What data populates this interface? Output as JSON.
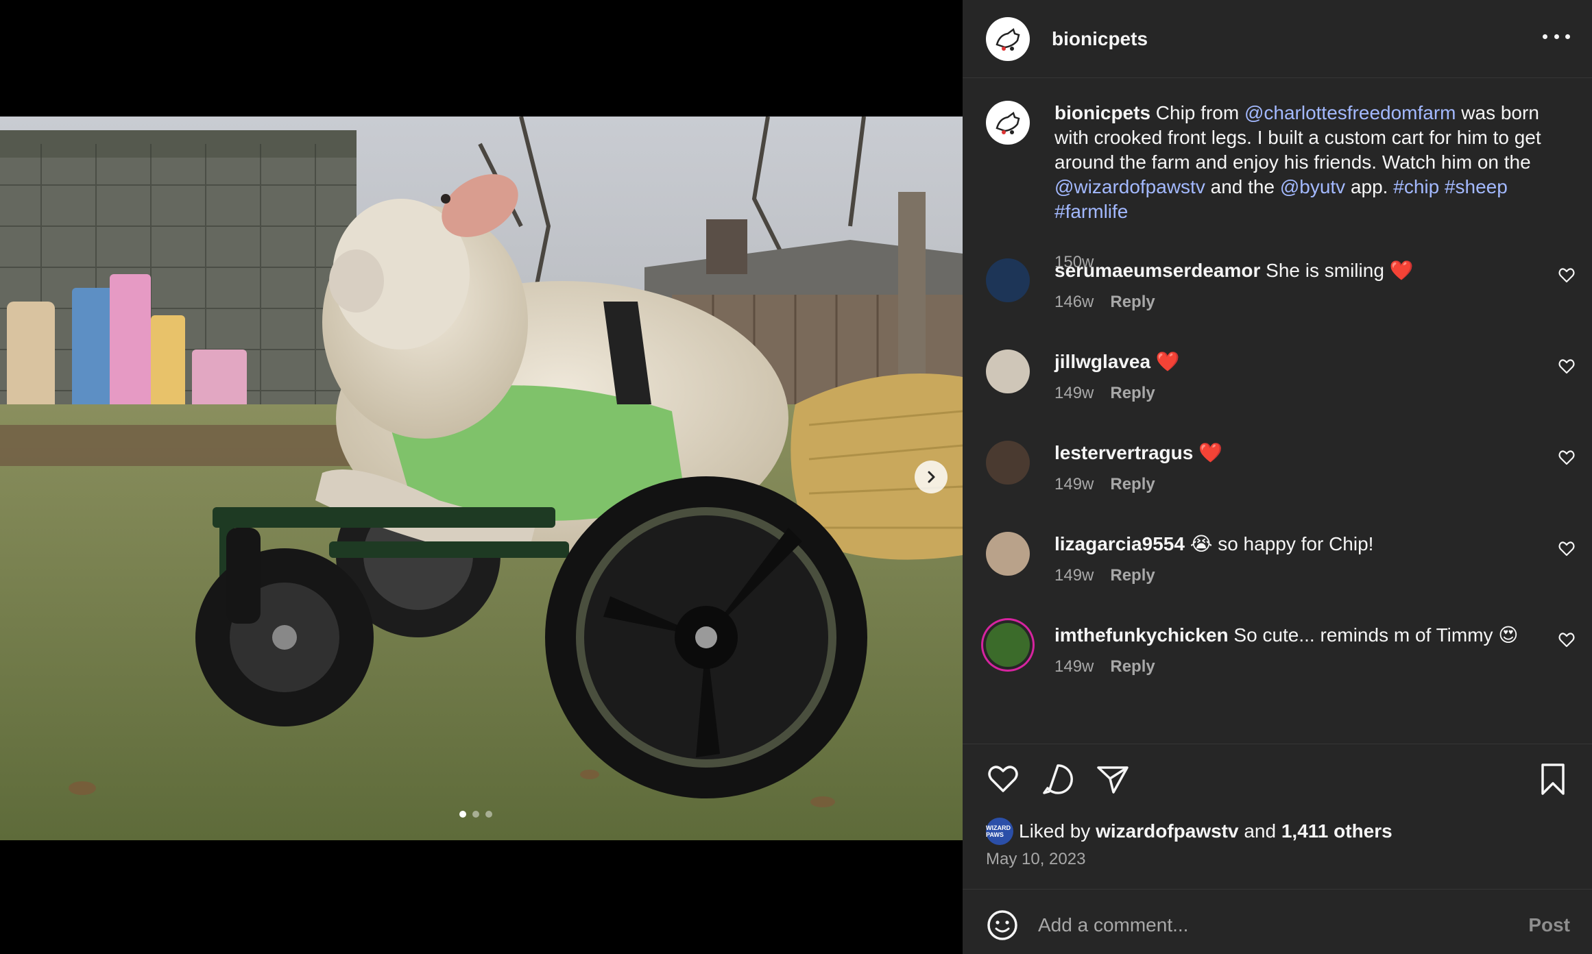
{
  "post": {
    "username": "bionicpets",
    "caption": {
      "user": "bionicpets",
      "parts": [
        {
          "text": " Chip from ",
          "mention": false
        },
        {
          "text": "@charlottesfreedomfarm",
          "mention": true
        },
        {
          "text": " was born with crooked front legs. I built a custom cart for him to get around the farm and enjoy his friends. Watch him on the ",
          "mention": false
        },
        {
          "text": "@wizardofpawstv",
          "mention": true
        },
        {
          "text": " and the ",
          "mention": false
        },
        {
          "text": "@byutv",
          "mention": true
        },
        {
          "text": " app. ",
          "mention": false
        },
        {
          "text": "#chip",
          "mention": true
        },
        {
          "text": " ",
          "mention": false
        },
        {
          "text": "#sheep",
          "mention": true
        },
        {
          "text": " ",
          "mention": false
        },
        {
          "text": "#farmlife",
          "mention": true
        }
      ],
      "age": "150w"
    },
    "comments": [
      {
        "user": "serumaeumserdeamor",
        "text": "She is smiling ❤️",
        "age": "146w",
        "reply": "Reply",
        "avatar_color": "#1d3557"
      },
      {
        "user": "jillwglavea",
        "text": "❤️",
        "age": "149w",
        "reply": "Reply",
        "avatar_color": "#cfc6b8"
      },
      {
        "user": "lestervertragus",
        "text": "❤️",
        "age": "149w",
        "reply": "Reply",
        "avatar_color": "#4a3a30"
      },
      {
        "user": "lizagarcia9554",
        "text": "😭 so happy for Chip!",
        "age": "149w",
        "reply": "Reply",
        "avatar_color": "#b9a28a"
      },
      {
        "user": "imthefunkychicken",
        "text": "So cute... reminds m of Timmy 😍",
        "age": "149w",
        "reply": "Reply",
        "avatar_color": "#3b6b2a"
      }
    ],
    "likes": {
      "prefix": "Liked by",
      "user": "wizardofpawstv",
      "and": "and",
      "others": "1,411 others",
      "mini_avatar_text": "WIZARD PAWS"
    },
    "date": "May 10, 2023",
    "add_comment": {
      "placeholder": "Add a comment...",
      "post_label": "Post"
    },
    "carousel": {
      "total": 3,
      "active": 1
    }
  },
  "colors": {
    "panel_bg": "#262626",
    "mention": "#a3b9ff",
    "muted": "#a8a8a8",
    "heart_red": "#ff3040"
  },
  "icons": [
    "more-icon",
    "heart-icon",
    "comment-icon",
    "share-icon",
    "bookmark-icon",
    "emoji-icon",
    "chevron-right-icon"
  ]
}
